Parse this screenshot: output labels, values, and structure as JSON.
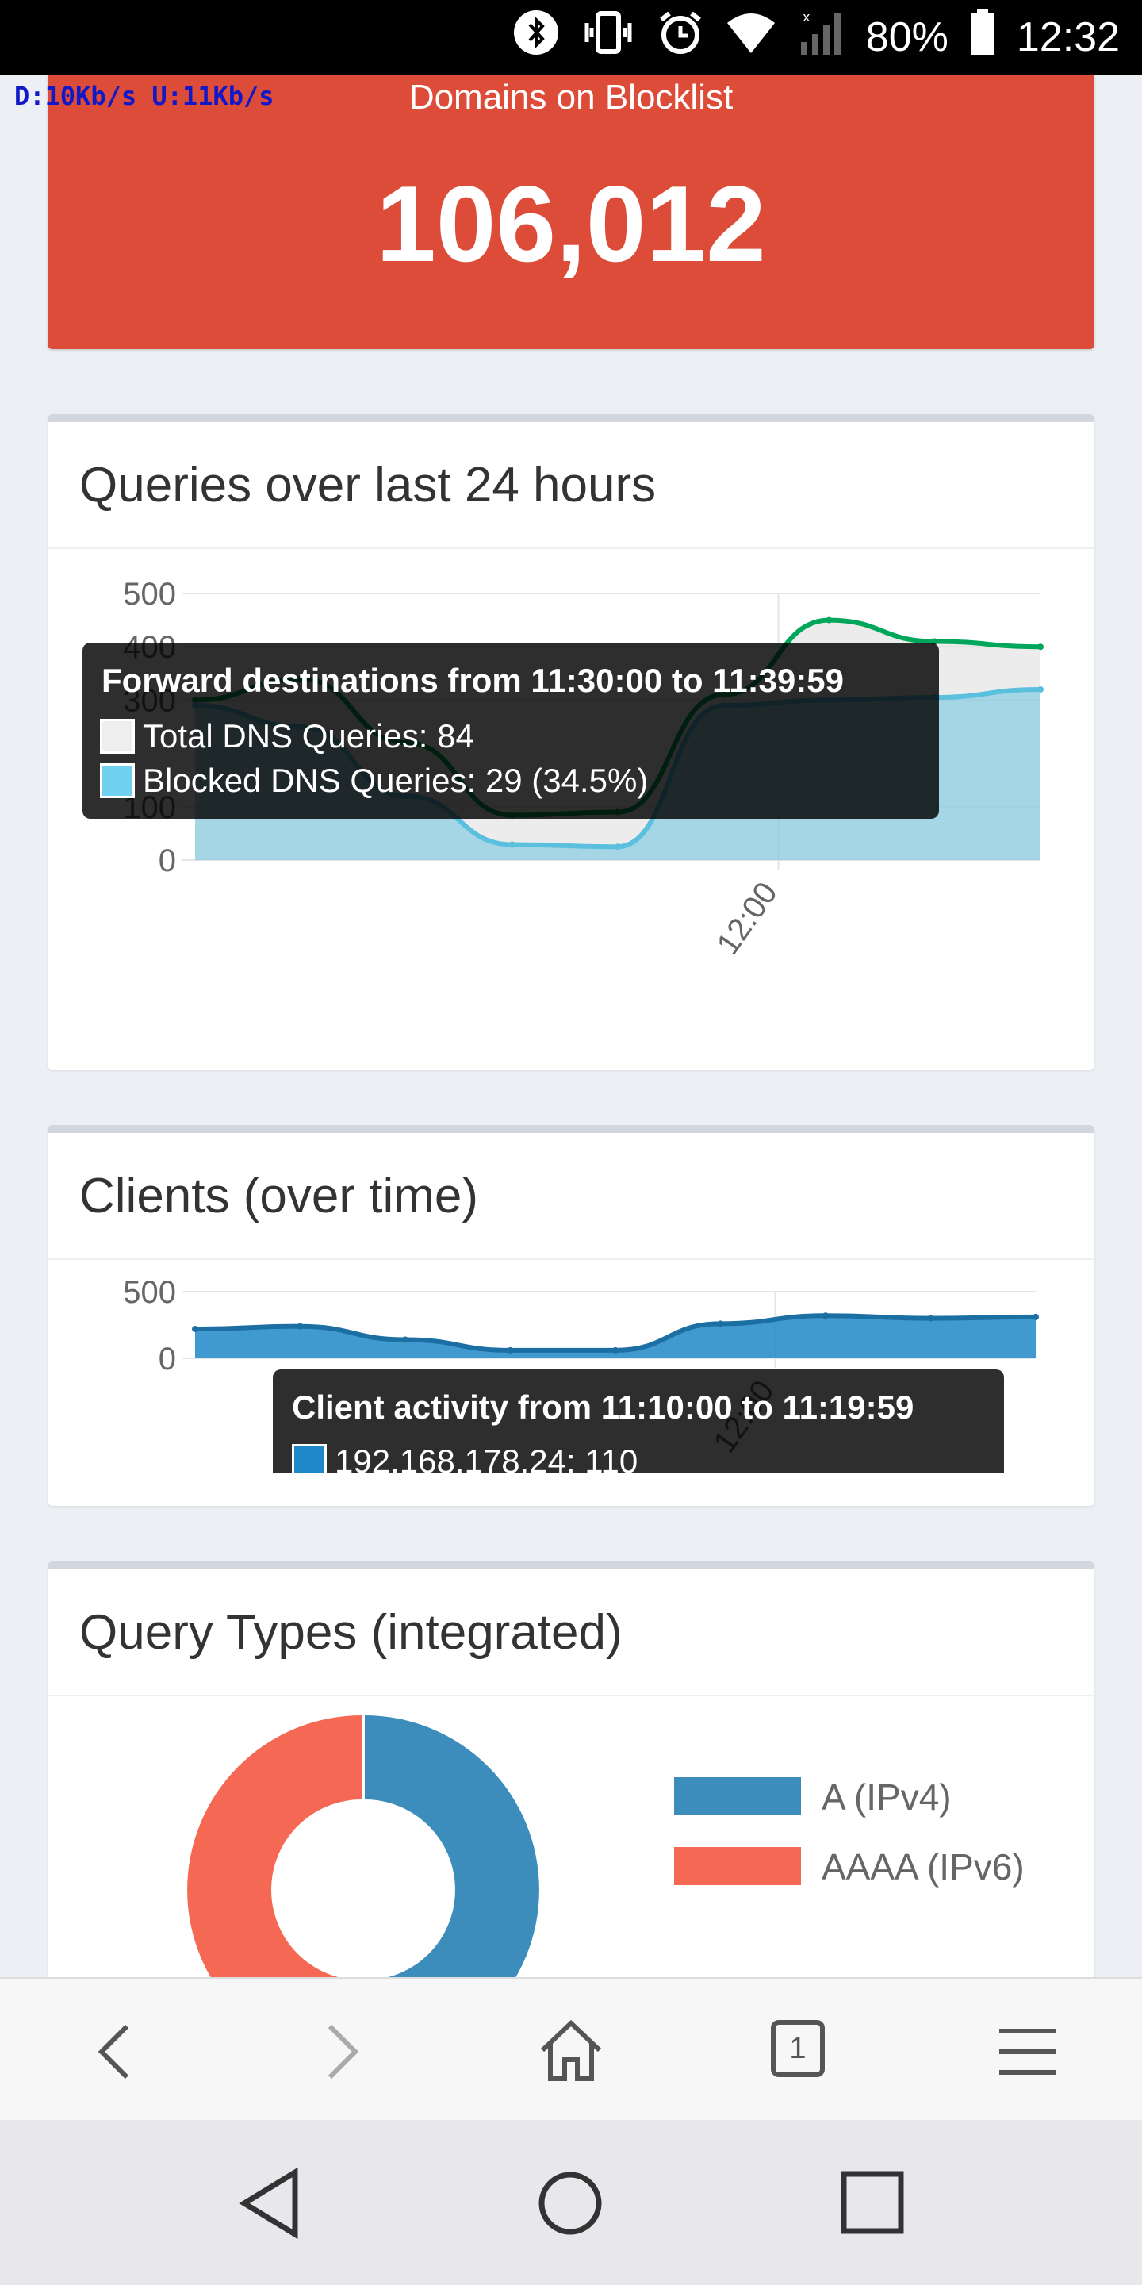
{
  "status_bar": {
    "battery": "80%",
    "time": "12:32"
  },
  "net_speed": {
    "download": "D:10Kb/s",
    "upload": "U:11Kb/s"
  },
  "blocklist": {
    "label": "Domains on Blocklist",
    "value": "106,012"
  },
  "queries_card": {
    "title": "Queries over last 24 hours",
    "tooltip": {
      "title": "Forward destinations from 11:30:00 to 11:39:59",
      "rows": [
        "Total DNS Queries: 84",
        "Blocked DNS Queries: 29 (34.5%)"
      ]
    }
  },
  "clients_card": {
    "title": "Clients (over time)",
    "tooltip": {
      "title": "Client activity from 11:10:00 to 11:19:59",
      "row": "192.168.178.24: 110"
    }
  },
  "query_types_card": {
    "title": "Query Types (integrated)",
    "legend": [
      {
        "label": "A (IPv4)",
        "color": "#3c8dbc"
      },
      {
        "label": "AAAA (IPv6)",
        "color": "#f56954"
      }
    ]
  },
  "colors": {
    "total": "#00a65a",
    "blocked": "#5bc0de",
    "red_box": "#dd4b39"
  },
  "chart_data": [
    {
      "type": "area",
      "title": "Queries over last 24 hours",
      "yticks": [
        "0",
        "100",
        "300",
        "400",
        "500"
      ],
      "ylim": [
        0,
        500
      ],
      "x_ticks": [
        "12:00"
      ],
      "series": [
        {
          "name": "Total DNS Queries",
          "values": [
            300,
            340,
            220,
            84,
            90,
            310,
            450,
            410,
            400
          ]
        },
        {
          "name": "Blocked DNS Queries",
          "values": [
            290,
            250,
            120,
            29,
            25,
            290,
            300,
            305,
            320
          ]
        }
      ]
    },
    {
      "type": "area",
      "title": "Clients (over time)",
      "yticks": [
        "0",
        "500"
      ],
      "ylim": [
        0,
        500
      ],
      "x_ticks": [
        "12:00"
      ],
      "series": [
        {
          "name": "192.168.178.24",
          "values": [
            220,
            240,
            140,
            60,
            60,
            260,
            320,
            300,
            310
          ]
        }
      ]
    }
  ],
  "browser_bar": {
    "tab_count": "1"
  }
}
